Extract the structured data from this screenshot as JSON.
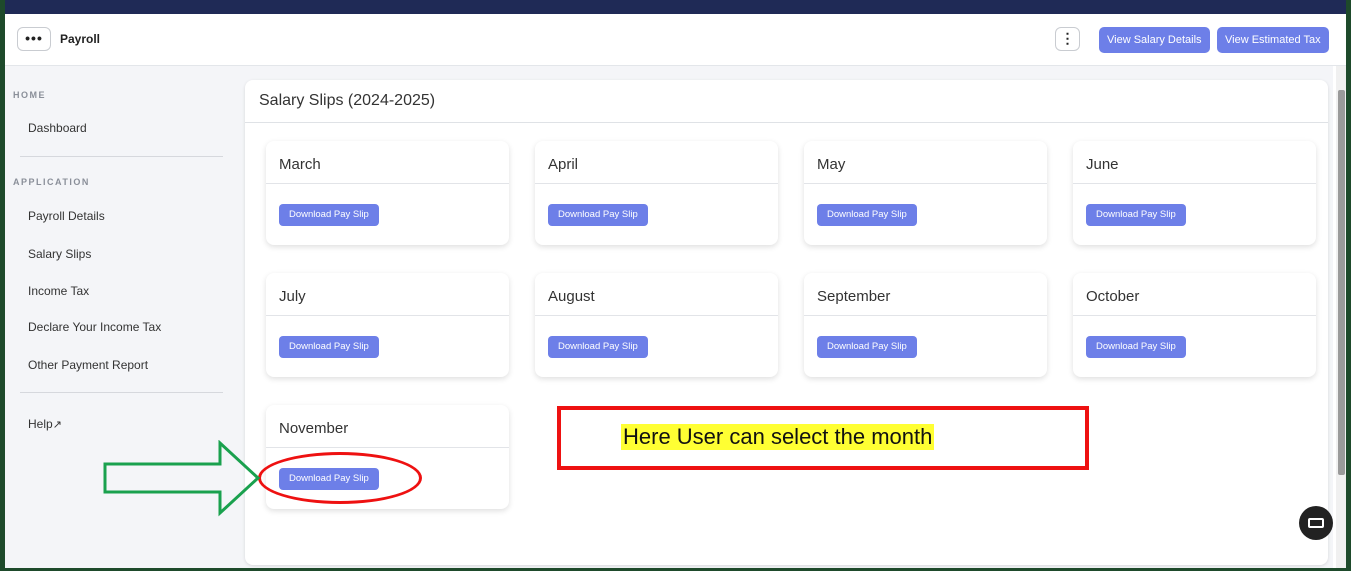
{
  "header": {
    "menu_glyph": "•••",
    "title": "Payroll",
    "kebab_glyph": "⋮",
    "buttons": [
      "View Salary Details",
      "View Estimated Tax"
    ]
  },
  "sidebar": {
    "sections": [
      "HOME",
      "APPLICATION"
    ],
    "home_items": [
      "Dashboard"
    ],
    "app_items": [
      "Payroll Details",
      "Salary Slips",
      "Income Tax",
      "Declare Your Income Tax",
      "Other Payment Report"
    ],
    "help_label": "Help"
  },
  "main": {
    "title": "Salary Slips (2024-2025)",
    "months": [
      "March",
      "April",
      "May",
      "June",
      "July",
      "August",
      "September",
      "October",
      "November"
    ],
    "download_label": "Download Pay Slip"
  },
  "annotation": {
    "callout_text": "Here User can select the month",
    "callout_color": "#ee1111",
    "highlight_color": "#ffff33",
    "arrow_color": "#1aa14e"
  },
  "colors": {
    "accent": "#6d7fe8",
    "frame": "#1e4a2b"
  }
}
